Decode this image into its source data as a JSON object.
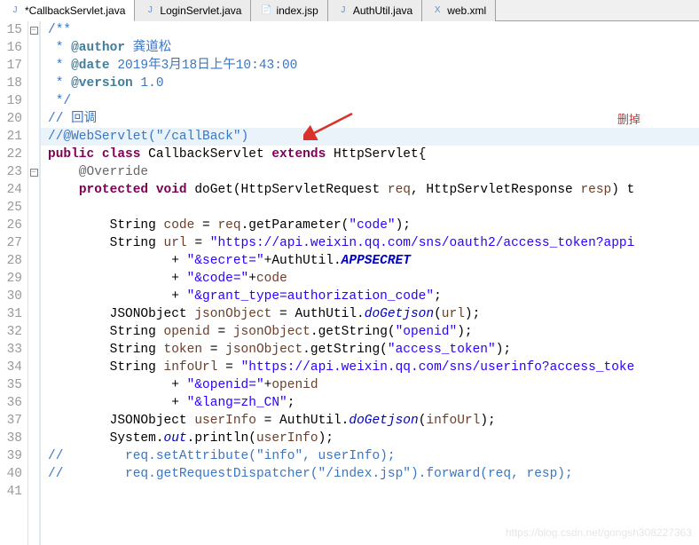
{
  "tabs": [
    {
      "label": "*CallbackServlet.java",
      "type": "java",
      "active": true
    },
    {
      "label": "LoginServlet.java",
      "type": "java",
      "active": false
    },
    {
      "label": "index.jsp",
      "type": "jsp",
      "active": false
    },
    {
      "label": "AuthUtil.java",
      "type": "java",
      "active": false
    },
    {
      "label": "web.xml",
      "type": "xml",
      "active": false
    }
  ],
  "annotation": {
    "label": "删掉"
  },
  "watermark": "https://blog.csdn.net/gongsh308227363",
  "lines": [
    {
      "n": "15",
      "fold": "minus",
      "seg": [
        {
          "t": "/**",
          "c": "c-comment"
        }
      ]
    },
    {
      "n": "16",
      "seg": [
        {
          "t": " * ",
          "c": "c-comment"
        },
        {
          "t": "@author",
          "c": "c-tag"
        },
        {
          "t": " 龚道松",
          "c": "c-comment"
        }
      ]
    },
    {
      "n": "17",
      "seg": [
        {
          "t": " * ",
          "c": "c-comment"
        },
        {
          "t": "@date",
          "c": "c-tag"
        },
        {
          "t": " 2019年3月18日上午10:43:00",
          "c": "c-comment"
        }
      ]
    },
    {
      "n": "18",
      "seg": [
        {
          "t": " * ",
          "c": "c-comment"
        },
        {
          "t": "@version",
          "c": "c-tag"
        },
        {
          "t": " 1.0",
          "c": "c-comment"
        }
      ]
    },
    {
      "n": "19",
      "seg": [
        {
          "t": " */",
          "c": "c-comment"
        }
      ]
    },
    {
      "n": "20",
      "seg": [
        {
          "t": "// 回调",
          "c": "c-comment"
        }
      ]
    },
    {
      "n": "21",
      "hl": true,
      "arrow": true,
      "seg": [
        {
          "t": "//@WebServlet(\"/callBack\")",
          "c": "c-comment"
        }
      ]
    },
    {
      "n": "22",
      "seg": [
        {
          "t": "public class ",
          "c": "c-kw"
        },
        {
          "t": "CallbackServlet "
        },
        {
          "t": "extends ",
          "c": "c-kw"
        },
        {
          "t": "HttpServlet{"
        }
      ]
    },
    {
      "n": "23",
      "fold": "minus",
      "seg": [
        {
          "t": "    @Override",
          "c": "c-annotation"
        }
      ]
    },
    {
      "n": "24",
      "seg": [
        {
          "t": "    "
        },
        {
          "t": "protected void ",
          "c": "c-kw"
        },
        {
          "t": "doGet(HttpServletRequest "
        },
        {
          "t": "req",
          "c": "c-ident"
        },
        {
          "t": ", HttpServletResponse "
        },
        {
          "t": "resp",
          "c": "c-ident"
        },
        {
          "t": ") t"
        }
      ]
    },
    {
      "n": "25",
      "seg": [
        {
          "t": ""
        }
      ]
    },
    {
      "n": "26",
      "seg": [
        {
          "t": "        String "
        },
        {
          "t": "code",
          "c": "c-ident"
        },
        {
          "t": " = "
        },
        {
          "t": "req",
          "c": "c-ident"
        },
        {
          "t": ".getParameter("
        },
        {
          "t": "\"code\"",
          "c": "c-str"
        },
        {
          "t": ");"
        }
      ]
    },
    {
      "n": "27",
      "seg": [
        {
          "t": "        String "
        },
        {
          "t": "url",
          "c": "c-ident"
        },
        {
          "t": " = "
        },
        {
          "t": "\"https://api.weixin.qq.com/sns/oauth2/access_token?appi",
          "c": "c-str"
        }
      ]
    },
    {
      "n": "28",
      "seg": [
        {
          "t": "                + "
        },
        {
          "t": "\"&secret=\"",
          "c": "c-str"
        },
        {
          "t": "+AuthUtil."
        },
        {
          "t": "APPSECRET",
          "c": "c-staticbold"
        }
      ]
    },
    {
      "n": "29",
      "seg": [
        {
          "t": "                + "
        },
        {
          "t": "\"&code=\"",
          "c": "c-str"
        },
        {
          "t": "+"
        },
        {
          "t": "code",
          "c": "c-ident"
        }
      ]
    },
    {
      "n": "30",
      "seg": [
        {
          "t": "                + "
        },
        {
          "t": "\"&grant_type=authorization_code\"",
          "c": "c-str"
        },
        {
          "t": ";"
        }
      ]
    },
    {
      "n": "31",
      "seg": [
        {
          "t": "        JSONObject "
        },
        {
          "t": "jsonObject",
          "c": "c-ident"
        },
        {
          "t": " = AuthUtil."
        },
        {
          "t": "doGetjson",
          "c": "c-static"
        },
        {
          "t": "("
        },
        {
          "t": "url",
          "c": "c-ident"
        },
        {
          "t": ");"
        }
      ]
    },
    {
      "n": "32",
      "seg": [
        {
          "t": "        String "
        },
        {
          "t": "openid",
          "c": "c-ident"
        },
        {
          "t": " = "
        },
        {
          "t": "jsonObject",
          "c": "c-ident"
        },
        {
          "t": ".getString("
        },
        {
          "t": "\"openid\"",
          "c": "c-str"
        },
        {
          "t": ");"
        }
      ]
    },
    {
      "n": "33",
      "seg": [
        {
          "t": "        String "
        },
        {
          "t": "token",
          "c": "c-ident"
        },
        {
          "t": " = "
        },
        {
          "t": "jsonObject",
          "c": "c-ident"
        },
        {
          "t": ".getString("
        },
        {
          "t": "\"access_token\"",
          "c": "c-str"
        },
        {
          "t": ");"
        }
      ]
    },
    {
      "n": "34",
      "seg": [
        {
          "t": "        String "
        },
        {
          "t": "infoUrl",
          "c": "c-ident"
        },
        {
          "t": " = "
        },
        {
          "t": "\"https://api.weixin.qq.com/sns/userinfo?access_toke",
          "c": "c-str"
        }
      ]
    },
    {
      "n": "35",
      "seg": [
        {
          "t": "                + "
        },
        {
          "t": "\"&openid=\"",
          "c": "c-str"
        },
        {
          "t": "+"
        },
        {
          "t": "openid",
          "c": "c-ident"
        }
      ]
    },
    {
      "n": "36",
      "seg": [
        {
          "t": "                + "
        },
        {
          "t": "\"&lang=zh_CN\"",
          "c": "c-str"
        },
        {
          "t": ";"
        }
      ]
    },
    {
      "n": "37",
      "seg": [
        {
          "t": "        JSONObject "
        },
        {
          "t": "userInfo",
          "c": "c-ident"
        },
        {
          "t": " = AuthUtil."
        },
        {
          "t": "doGetjson",
          "c": "c-static"
        },
        {
          "t": "("
        },
        {
          "t": "infoUrl",
          "c": "c-ident"
        },
        {
          "t": ");"
        }
      ]
    },
    {
      "n": "38",
      "seg": [
        {
          "t": "        System."
        },
        {
          "t": "out",
          "c": "c-static"
        },
        {
          "t": ".println("
        },
        {
          "t": "userInfo",
          "c": "c-ident"
        },
        {
          "t": ");"
        }
      ]
    },
    {
      "n": "39",
      "seg": [
        {
          "t": "//        req.setAttribute(\"info\", userInfo);",
          "c": "c-comment"
        }
      ]
    },
    {
      "n": "40",
      "seg": [
        {
          "t": "//        req.getRequestDispatcher(\"/index.jsp\").forward(req, resp);",
          "c": "c-comment"
        }
      ]
    },
    {
      "n": "41",
      "seg": [
        {
          "t": ""
        }
      ]
    }
  ]
}
